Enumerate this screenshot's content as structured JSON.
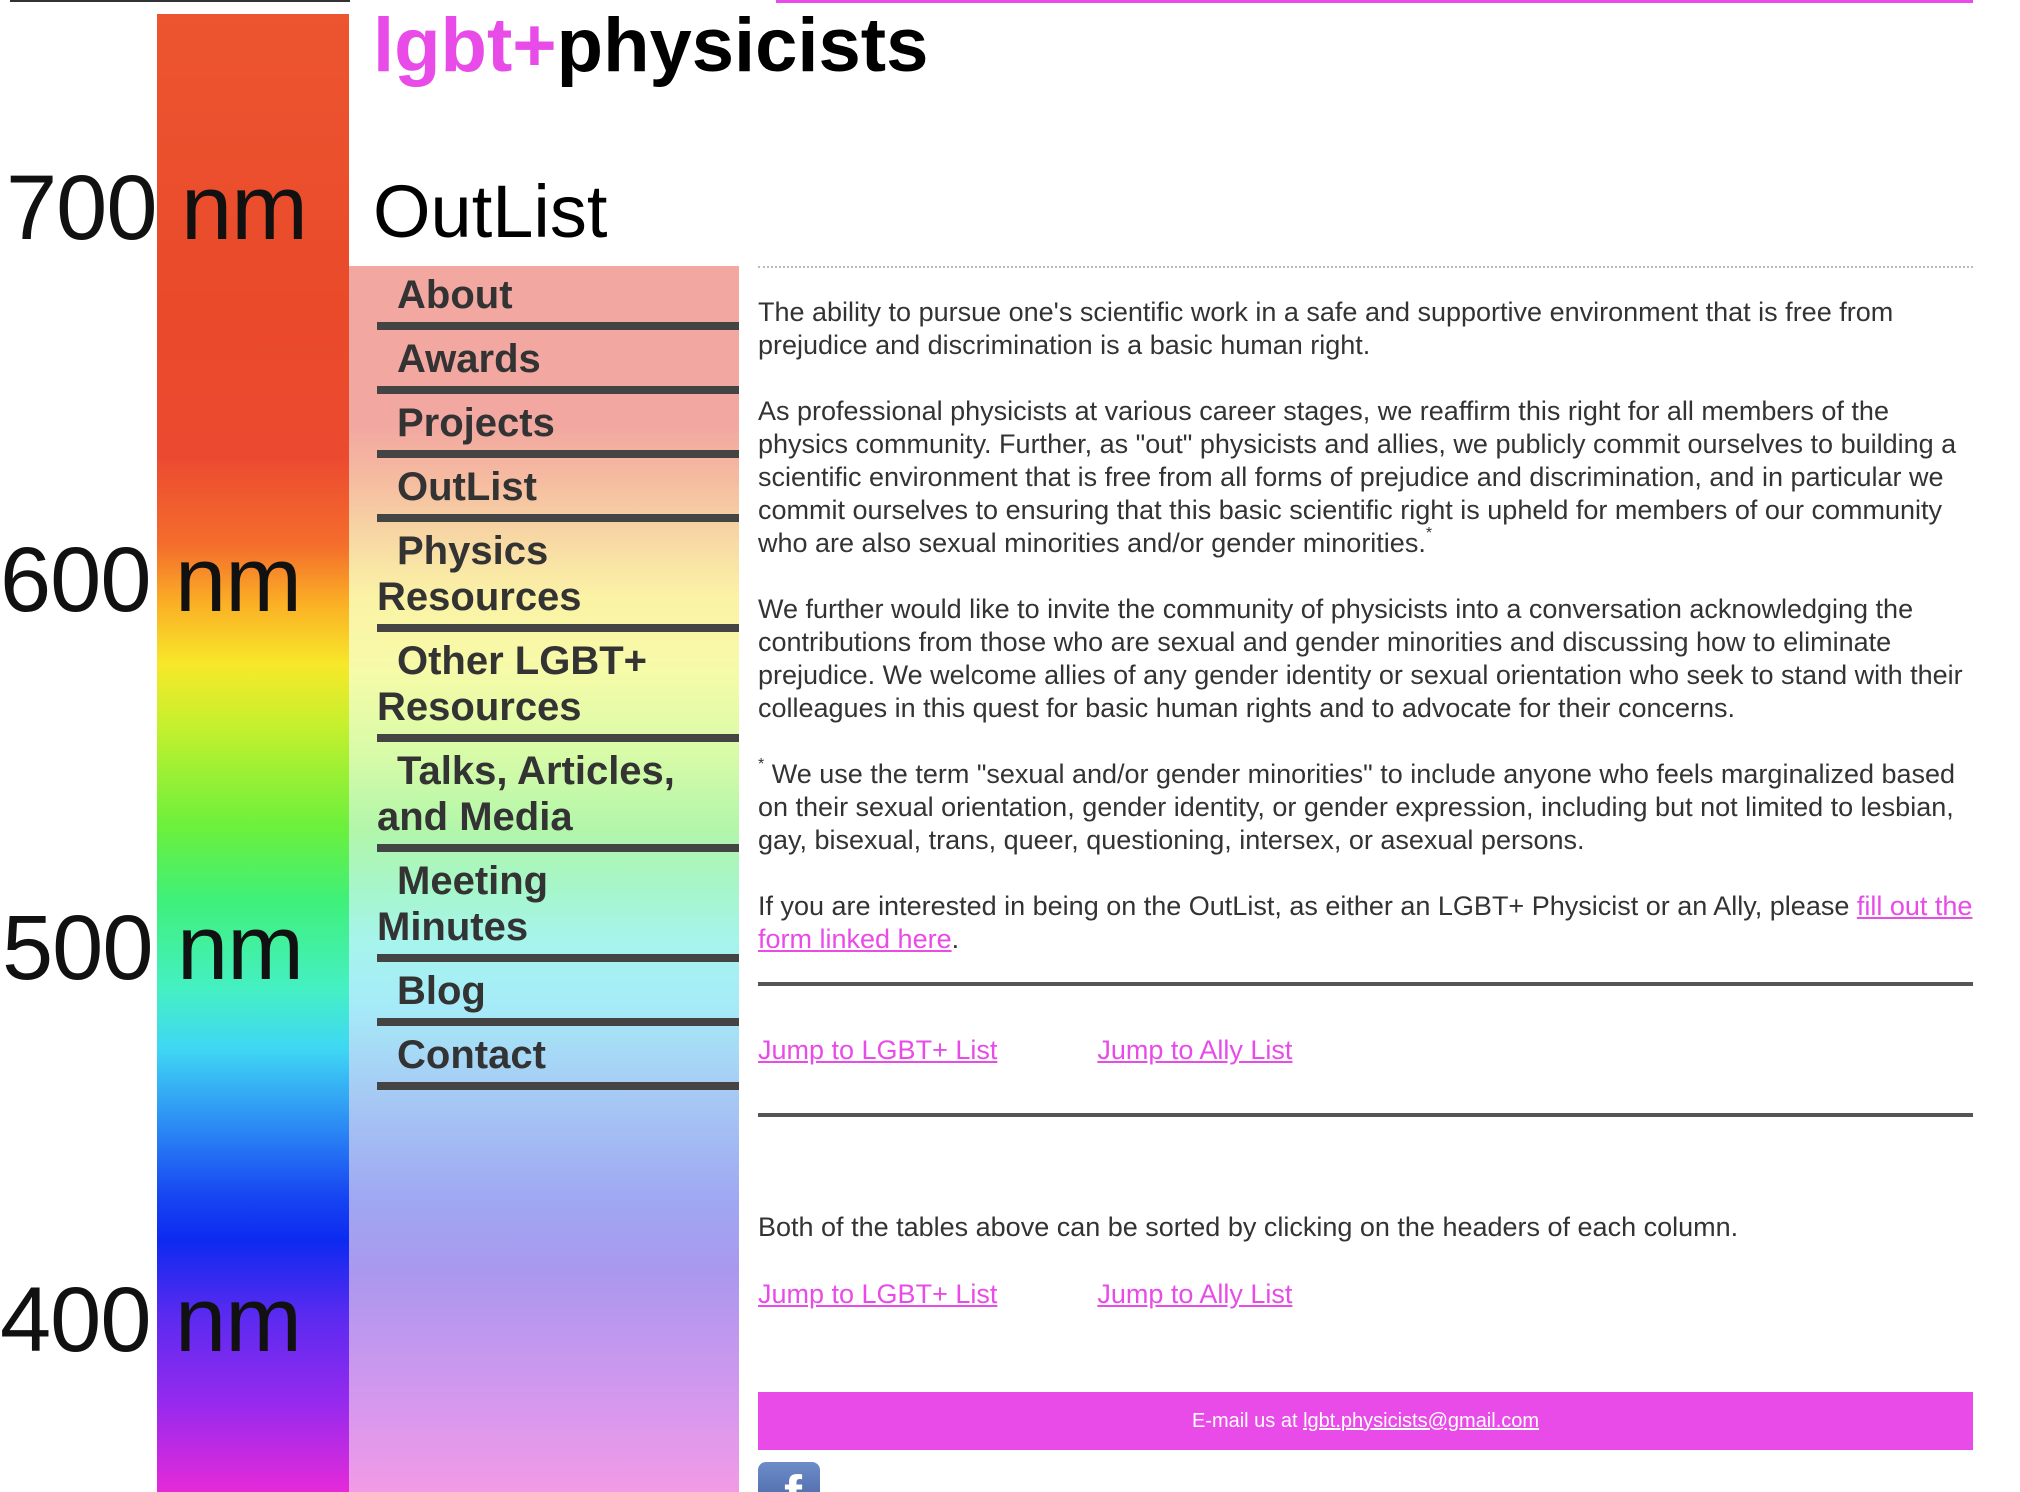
{
  "colors": {
    "brand_pink": "#e84be8",
    "text_gray": "#333333",
    "nav_rule": "#444444"
  },
  "spectrum": {
    "labels": [
      "700 nm",
      "600 nm",
      "500 nm",
      "400 nm"
    ]
  },
  "header": {
    "site_title_prefix": "lgbt+",
    "site_title_suffix": "physicists",
    "page_title": "OutList"
  },
  "nav": {
    "items": [
      {
        "line1": "About",
        "line2": ""
      },
      {
        "line1": "Awards",
        "line2": ""
      },
      {
        "line1": "Projects",
        "line2": ""
      },
      {
        "line1": "OutList",
        "line2": ""
      },
      {
        "line1": "Physics",
        "line2": "Resources"
      },
      {
        "line1": "Other LGBT+",
        "line2": "Resources"
      },
      {
        "line1": "Talks, Articles,",
        "line2": "and Media"
      },
      {
        "line1": "Meeting",
        "line2": "Minutes"
      },
      {
        "line1": "Blog",
        "line2": ""
      },
      {
        "line1": "Contact",
        "line2": ""
      }
    ]
  },
  "main": {
    "p1": "The ability to pursue one's scientific work in a safe and supportive environment that is free from prejudice and discrimination is a basic human right.",
    "p2": "As professional physicists at various career stages, we reaffirm this right for all members of the physics community. Further, as \"out\" physicists and allies, we publicly commit ourselves to building a scientific environment that is free from all forms of prejudice and discrimination, and in particular we commit ourselves to ensuring that this basic scientific right is upheld for members of our community who are also sexual minorities and/or gender minorities.",
    "footnote_mark": "*",
    "p3": "We further would like to invite the community of physicists into a conversation acknowledging the contributions from those who are sexual and gender minorities and discussing how to eliminate prejudice. We welcome allies of any gender identity or sexual orientation who seek to stand with their colleagues in this quest for basic human rights and to advocate for their concerns.",
    "footnote": " We use the term \"sexual and/or gender minorities\" to include anyone who feels marginalized based on their sexual orientation, gender identity, or gender expression, including but not limited to lesbian, gay, bisexual, trans, queer, questioning, intersex, or asexual persons.",
    "p5_before": "If you are interested in being on the OutList, as either an LGBT+ Physicist or an Ally, please ",
    "p5_link": "fill out the form linked here",
    "p5_after": ".",
    "jump_lgbt": "Jump to LGBT+ List",
    "jump_ally": "Jump to Ally List",
    "sort_note": "Both of the tables above can be sorted by clicking on the headers of each column."
  },
  "footer": {
    "email_prefix": "E-mail us at ",
    "email": "lgbt.physicists@gmail.com",
    "facebook_glyph": "f"
  }
}
